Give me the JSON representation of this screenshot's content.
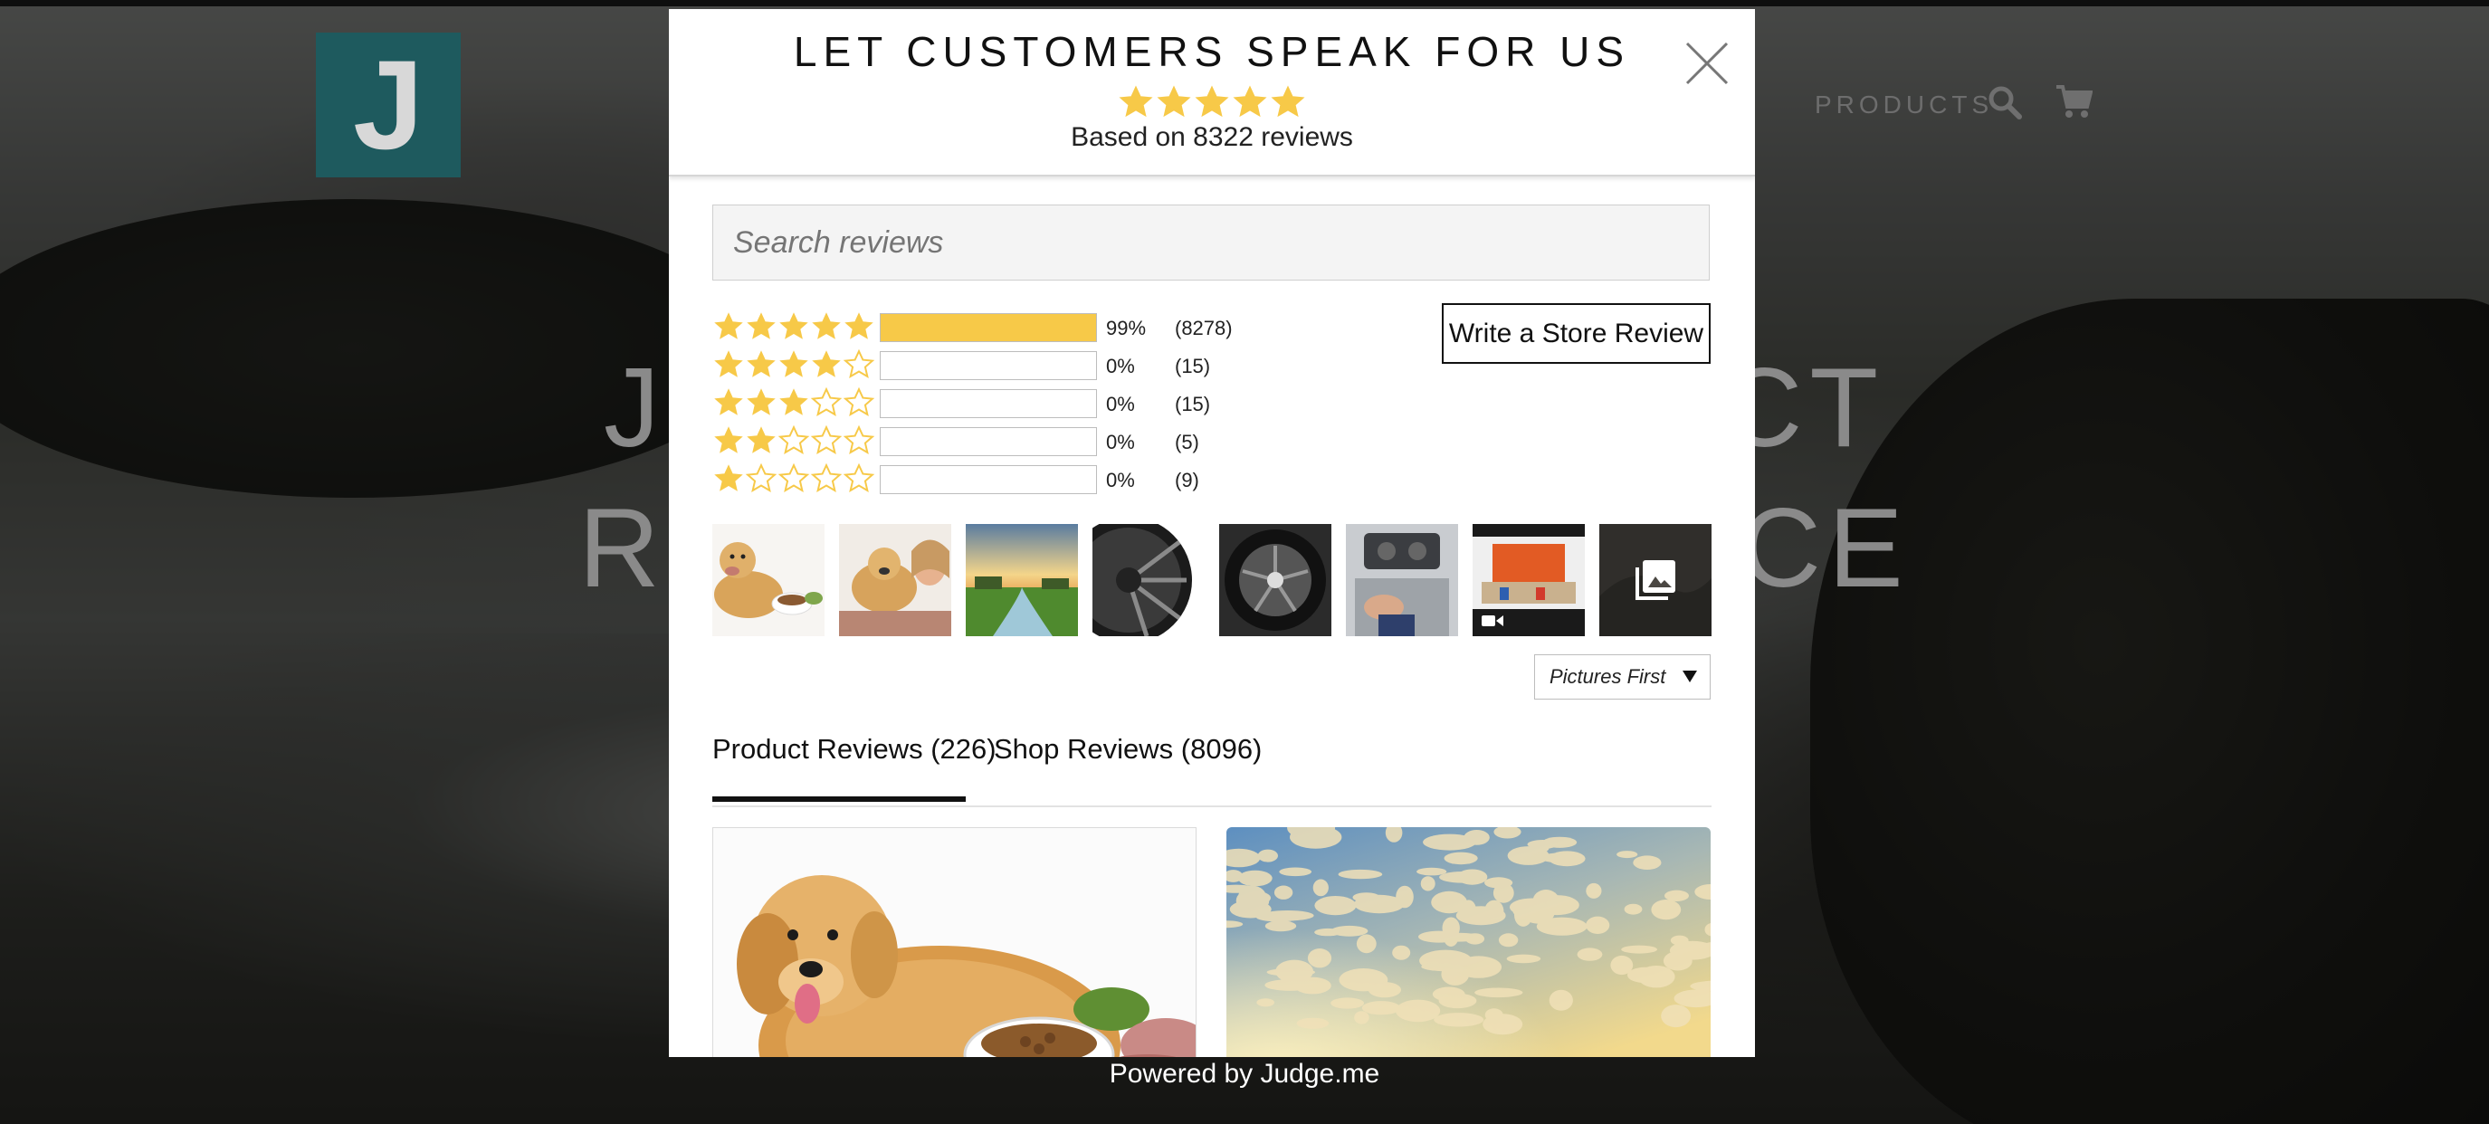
{
  "background": {
    "nav_products": "PRODUCTS",
    "logo_letter": "J",
    "hero_line_1": "JUDGE.ME PRODUCT",
    "hero_line_2": "REVIEWS COMMERCE"
  },
  "modal": {
    "title": "LET CUSTOMERS SPEAK FOR US",
    "rating_stars": 5,
    "subtitle": "Based on 8322 reviews",
    "search_placeholder": "Search reviews",
    "write_review_label": "Write a Store Review",
    "histogram": [
      {
        "stars": 5,
        "percent_label": "99%",
        "count_label": "(8278)",
        "fill": 1.0
      },
      {
        "stars": 4,
        "percent_label": "0%",
        "count_label": "(15)",
        "fill": 0
      },
      {
        "stars": 3,
        "percent_label": "0%",
        "count_label": "(15)",
        "fill": 0
      },
      {
        "stars": 2,
        "percent_label": "0%",
        "count_label": "(5)",
        "fill": 0
      },
      {
        "stars": 1,
        "percent_label": "0%",
        "count_label": "(9)",
        "fill": 0
      }
    ],
    "sort_selected": "Pictures First",
    "tabs": [
      {
        "label": "Product Reviews (226)",
        "active": true
      },
      {
        "label": "Shop Reviews (8096)",
        "active": false
      }
    ]
  },
  "footer": {
    "powered_by": "Powered by Judge.me"
  },
  "colors": {
    "star": "#f7c948",
    "bar_fill": "#f7c948"
  }
}
